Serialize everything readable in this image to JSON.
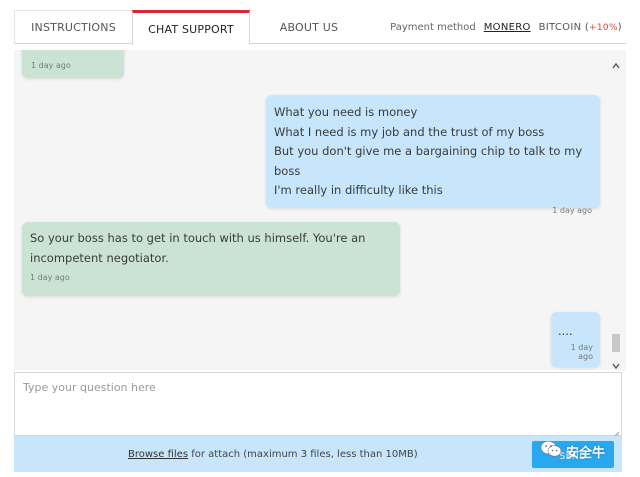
{
  "tabs": [
    {
      "label": "INSTRUCTIONS",
      "active": false
    },
    {
      "label": "CHAT SUPPORT",
      "active": true
    },
    {
      "label": "ABOUT US",
      "active": false
    }
  ],
  "payment": {
    "label": "Payment method",
    "monero": "MONERO",
    "bitcoin": "BITCOIN",
    "bitcoin_bonus_open": "(",
    "bitcoin_bonus": "+10%",
    "bitcoin_bonus_close": ")",
    "selected": "MONERO"
  },
  "messages": [
    {
      "side": "incoming",
      "lines": [],
      "time": "1 day ago"
    },
    {
      "side": "outgoing",
      "lines": [
        "What you need is money",
        "What I need is my job and the trust of my boss",
        "But you don't give me a bargaining chip to talk to my boss",
        "I'm really in difficulty like this"
      ],
      "time": "1 day ago"
    },
    {
      "side": "incoming",
      "lines": [
        "So your boss has to get in touch with us himself. You're an",
        "incompetent negotiator."
      ],
      "time": "1 day ago"
    },
    {
      "side": "outgoing",
      "lines": [
        "...."
      ],
      "time": "1 day ago"
    }
  ],
  "question": {
    "placeholder": "Type your question here",
    "value": ""
  },
  "attach": {
    "link": "Browse files",
    "text": " for attach (maximum 3 files, less than 10MB)"
  },
  "send_label": "SEND",
  "watermark": {
    "text": "安全牛",
    "icon": "wechat-icon"
  },
  "colors": {
    "accent_tab": "#d9272e",
    "incoming_bubble": "#cbe3d4",
    "outgoing_bubble": "#c7e6fb",
    "send_button": "#29a8ef",
    "bonus": "#e0443a"
  }
}
